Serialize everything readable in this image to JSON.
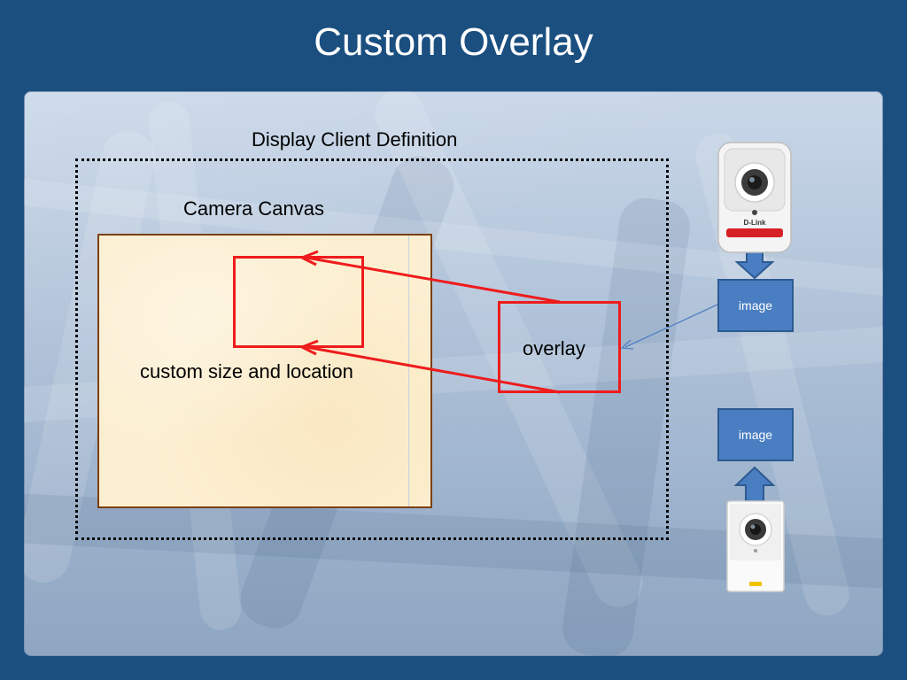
{
  "slide": {
    "title": "Custom Overlay"
  },
  "diagram": {
    "display_client_label": "Display Client Definition",
    "camera_canvas_label": "Camera Canvas",
    "custom_size_label": "custom size and location",
    "overlay_label": "overlay",
    "image_top_label": "image",
    "image_bottom_label": "image",
    "camera_top_brand": "D-Link",
    "colors": {
      "background": "#1b4f80",
      "red_arrows": "#ee1c1c",
      "blue_boxes": "#4a7ec2",
      "canvas_fill": "#fcefd1",
      "canvas_border": "#7b3f10"
    }
  }
}
